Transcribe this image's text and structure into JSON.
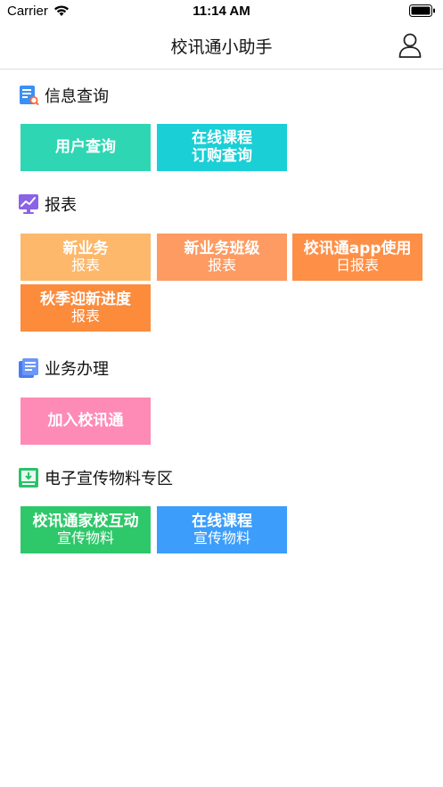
{
  "status_bar": {
    "carrier": "Carrier",
    "time": "11:14 AM"
  },
  "nav": {
    "title": "校讯通小助手",
    "user_icon": "user-icon"
  },
  "sections": [
    {
      "title": "信息查询",
      "icon": "search-document-icon",
      "tiles": [
        {
          "main": "用户查询",
          "sub": "",
          "color": "#2fd6b3"
        },
        {
          "main": "在线课程",
          "sub": "订购查询",
          "color": "#1bcfd6"
        }
      ]
    },
    {
      "title": "报表",
      "icon": "chart-icon",
      "tiles": [
        {
          "main": "新业务",
          "sub": "报表",
          "color": "#fdb86b"
        },
        {
          "main": "新业务班级",
          "sub": "报表",
          "color": "#fd9b63"
        },
        {
          "main": "校讯通app使用",
          "sub": "日报表",
          "color": "#fd8f47"
        },
        {
          "main": "秋季迎新进度",
          "sub": "报表",
          "color": "#fc8b3c"
        }
      ]
    },
    {
      "title": "业务办理",
      "icon": "document-icon",
      "tiles": [
        {
          "main": "加入校讯通",
          "sub": "",
          "color": "#fd8bb6"
        }
      ]
    },
    {
      "title": "电子宣传物料专区",
      "icon": "download-screen-icon",
      "tiles": [
        {
          "main": "校讯通家校互动",
          "sub": "宣传物料",
          "color": "#2ec86a"
        },
        {
          "main": "在线课程",
          "sub": "宣传物料",
          "color": "#3c9dfb"
        }
      ]
    }
  ]
}
